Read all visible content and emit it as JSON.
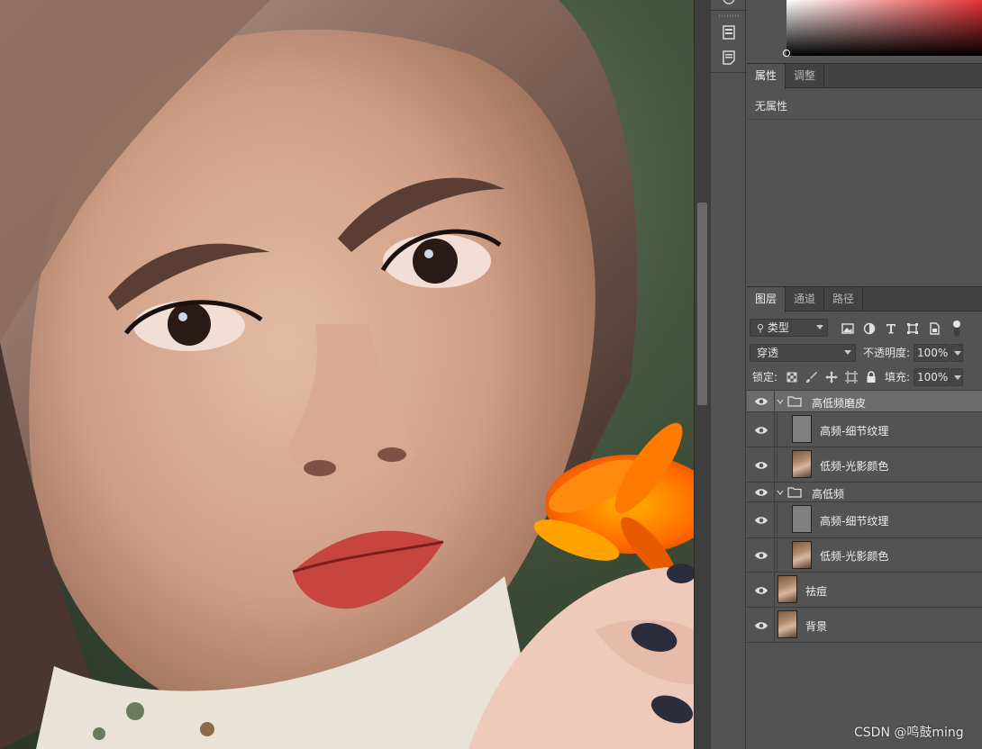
{
  "canvas": {
    "icon": "portrait-photo"
  },
  "properties": {
    "tabs": [
      {
        "label": "属性",
        "active": true
      },
      {
        "label": "调整",
        "active": false
      }
    ],
    "no_properties": "无属性"
  },
  "layers_panel": {
    "tabs": [
      {
        "label": "图层",
        "active": true
      },
      {
        "label": "通道",
        "active": false
      },
      {
        "label": "路径",
        "active": false
      }
    ],
    "filter_kind": "类型",
    "blend_mode": "穿透",
    "opacity_label": "不透明度:",
    "opacity_value": "100%",
    "lock_label": "锁定:",
    "fill_label": "填充:",
    "fill_value": "100%",
    "layers": [
      {
        "name": "高低频磨皮",
        "type": "group",
        "selected": true
      },
      {
        "name": "高频-细节纹理",
        "type": "gray-layer",
        "selected": false
      },
      {
        "name": "低频-光影颜色",
        "type": "photo-layer",
        "selected": false
      },
      {
        "name": "高低频",
        "type": "group",
        "selected": false
      },
      {
        "name": "高频-细节纹理",
        "type": "gray-layer",
        "selected": false
      },
      {
        "name": "低频-光影颜色",
        "type": "photo-layer",
        "selected": false
      },
      {
        "name": "祛痘",
        "type": "photo-layer",
        "selected": false
      },
      {
        "name": "背景",
        "type": "photo-layer",
        "selected": false
      }
    ]
  },
  "watermark": "CSDN @鸣鼓ming"
}
